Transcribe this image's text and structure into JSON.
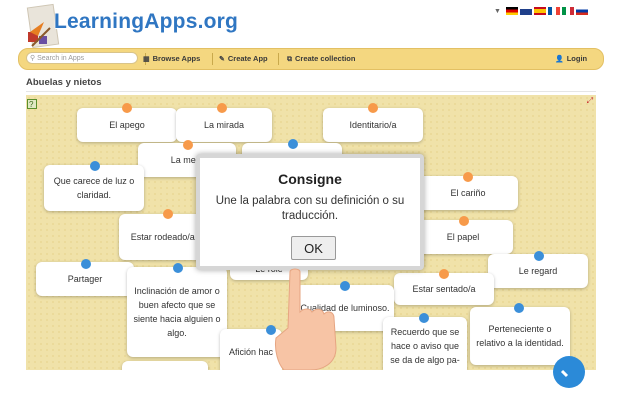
{
  "header": {
    "logo_text": "LearningApps.org",
    "languages": [
      "de",
      "en",
      "es",
      "fr",
      "it",
      "ru"
    ]
  },
  "toolbar": {
    "search_placeholder": "Search in Apps",
    "browse_label": "Browse Apps",
    "create_label": "Create App",
    "collection_label": "Create collection",
    "login_label": "Login"
  },
  "page": {
    "title": "Abuelas y nietos"
  },
  "cards": [
    {
      "text": "El apego"
    },
    {
      "text": "La mirada"
    },
    {
      "text": "Identitario/a"
    },
    {
      "text": "La mem"
    },
    {
      "text": "Que carece de luz o claridad."
    },
    {
      "text": "El cariño"
    },
    {
      "text": "Estar rodeado/a de"
    },
    {
      "text": "El papel"
    },
    {
      "text": "Partager"
    },
    {
      "text": "Le regard"
    },
    {
      "text": "Inclinación de amor o buen afecto que se siente hacia alguien o algo."
    },
    {
      "text": "Le rôle"
    },
    {
      "text": "Estar sentado/a"
    },
    {
      "text": "Cualidad de luminoso."
    },
    {
      "text": "Perteneciente o relativo a la identidad."
    },
    {
      "text": "Afición hac"
    },
    {
      "text": "Recuerdo que se hace o aviso que se da de algo pa-"
    }
  ],
  "dialog": {
    "title": "Consigne",
    "text": "Une la palabra con su definición o su traducción.",
    "ok_label": "OK"
  },
  "colors": {
    "brand_blue": "#2f76c2",
    "toolbar": "#f4d780",
    "pin_orange": "#f79a4a",
    "pin_blue": "#3b8fd9"
  }
}
